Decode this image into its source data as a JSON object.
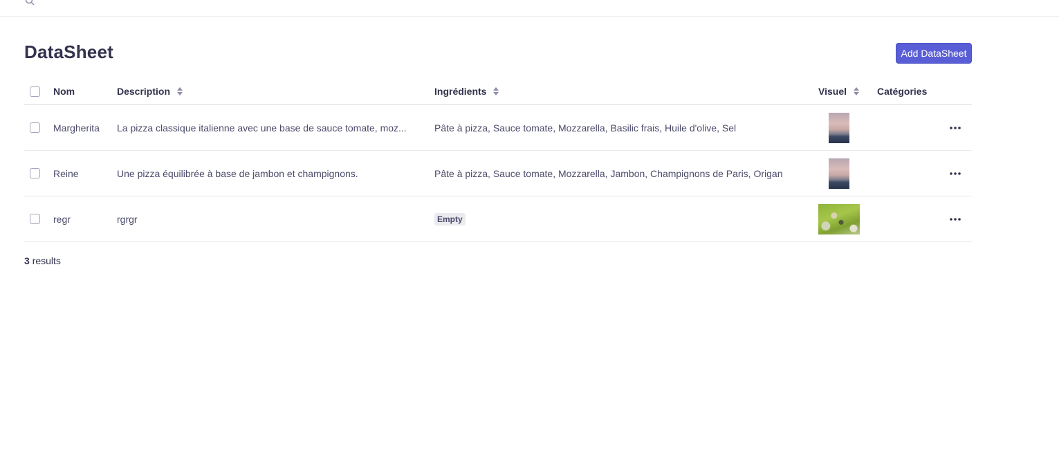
{
  "page": {
    "title": "DataSheet",
    "add_button_label": "Add DataSheet"
  },
  "table": {
    "headers": {
      "nom": "Nom",
      "description": "Description",
      "ingredients": "Ingrédients",
      "visuel": "Visuel",
      "categories": "Catégories"
    },
    "rows": [
      {
        "nom": "Margherita",
        "description": "La pizza classique italienne avec une base de sauce tomate, moz...",
        "ingredients": "Pâte à pizza, Sauce tomate, Mozzarella, Basilic frais, Huile d'olive, Sel",
        "visuel": "sunset-mountain-thumbnail",
        "categories": ""
      },
      {
        "nom": "Reine",
        "description": "Une pizza équilibrée à base de jambon et champignons.",
        "ingredients": "Pâte à pizza, Sauce tomate, Mozzarella, Jambon, Champignons de Paris, Origan",
        "visuel": "sunset-mountain-thumbnail",
        "categories": ""
      },
      {
        "nom": "regr",
        "description": "rgrgr",
        "ingredients_empty_label": "Empty",
        "visuel": "green-landscape-thumbnail",
        "categories": ""
      }
    ]
  },
  "footer": {
    "results_count": "3",
    "results_label": "results"
  },
  "colors": {
    "primary": "#5a5ed6",
    "text": "#32324d",
    "border": "#eaeaef"
  }
}
